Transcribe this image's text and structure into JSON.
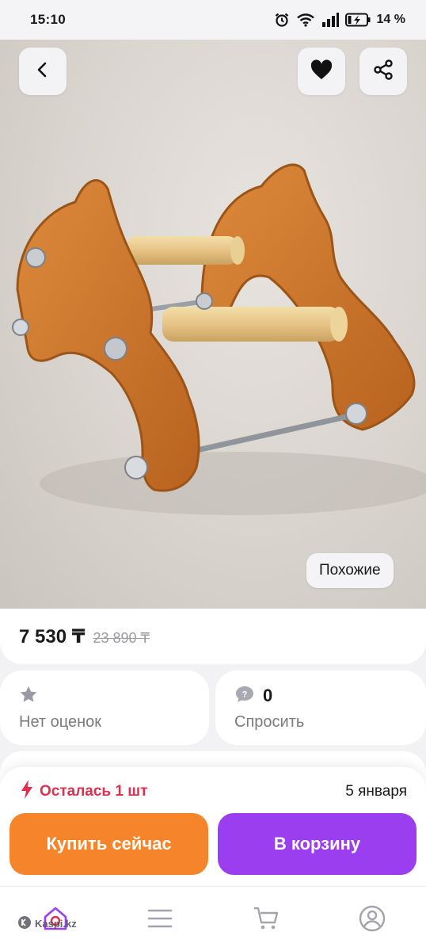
{
  "status_bar": {
    "time": "15:10",
    "battery_percent": "14 %",
    "icons": [
      "alarm-icon",
      "wifi-icon",
      "signal-icon",
      "battery-charging-icon"
    ]
  },
  "product": {
    "image_alt_name": "product-photo",
    "similar_label": "Похожие"
  },
  "price": {
    "current": "7 530 ₸",
    "old": "23 890 ₸"
  },
  "rating": {
    "label": "Нет оценок",
    "icon": "star-icon"
  },
  "questions": {
    "count": "0",
    "label": "Спросить",
    "icon": "chat-question-icon"
  },
  "purchase": {
    "stock_text": "Осталась 1 шт",
    "delivery_date": "5 января",
    "buy_now_label": "Купить сейчас",
    "add_to_cart_label": "В корзину"
  },
  "tab_bar": {
    "items": [
      "home-icon",
      "catalog-icon",
      "cart-icon",
      "profile-icon"
    ]
  },
  "watermark": {
    "text": "Kaspi.kz"
  },
  "colors": {
    "accent_orange": "#f5842b",
    "accent_purple": "#9a3ef0",
    "stock_red": "#e02e4e",
    "background": "#f2f2f4"
  }
}
